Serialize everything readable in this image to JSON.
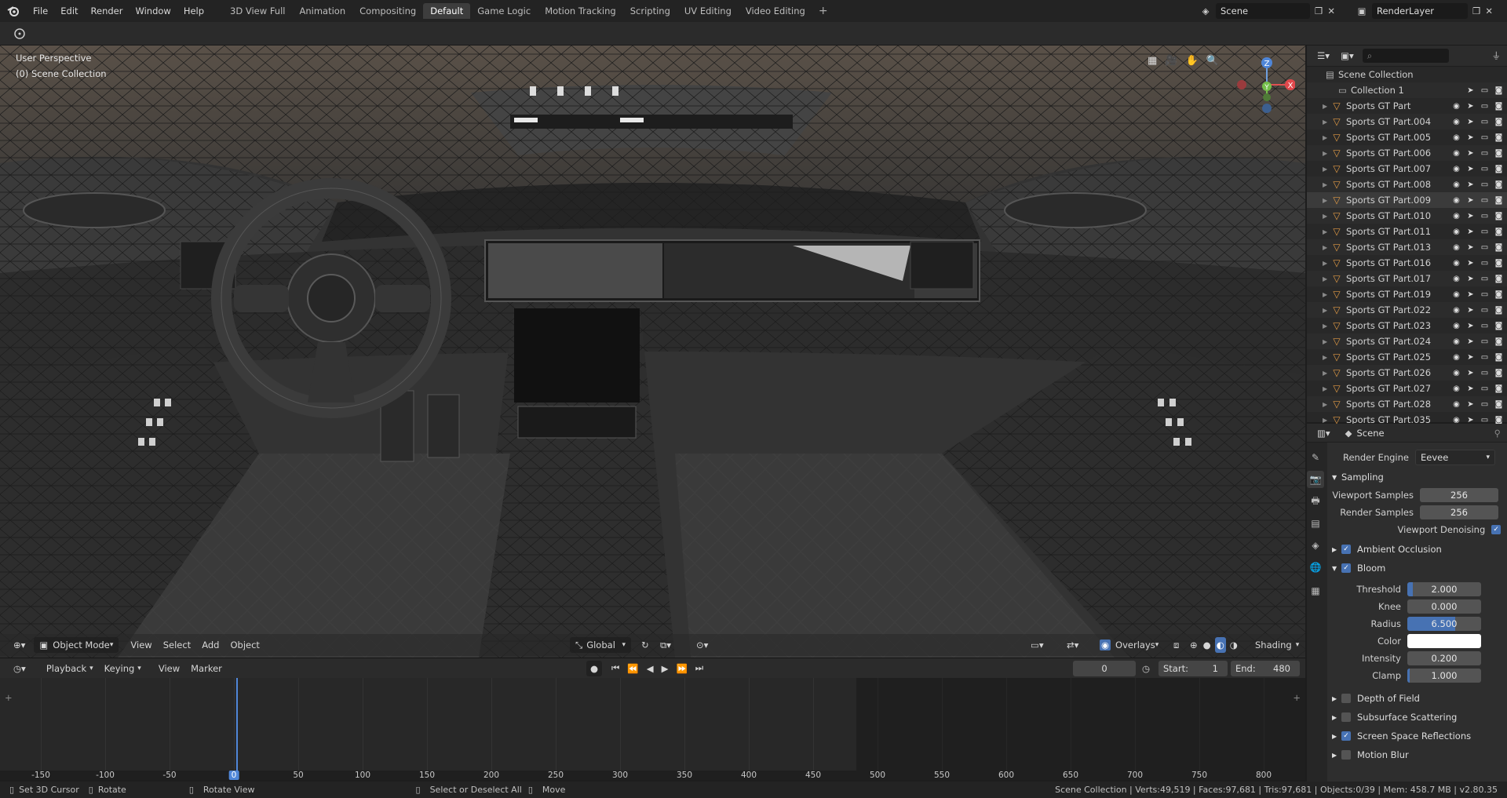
{
  "menu": {
    "items": [
      "File",
      "Edit",
      "Render",
      "Window",
      "Help"
    ]
  },
  "workspaces": {
    "tabs": [
      "3D View Full",
      "Animation",
      "Compositing",
      "Default",
      "Game Logic",
      "Motion Tracking",
      "Scripting",
      "UV Editing",
      "Video Editing"
    ],
    "active": "Default",
    "add_label": "+"
  },
  "scene": {
    "name": "Scene",
    "render_layer": "RenderLayer"
  },
  "viewport": {
    "perspective_label": "User Perspective",
    "collection_label": "(0) Scene Collection",
    "header": {
      "mode": "Object Mode",
      "view": "View",
      "select": "Select",
      "add": "Add",
      "object": "Object",
      "orientation": "Global",
      "overlays": "Overlays",
      "shading": "Shading"
    }
  },
  "timeline": {
    "playback": "Playback",
    "keying": "Keying",
    "view": "View",
    "marker": "Marker",
    "current_frame": "0",
    "start_label": "Start:",
    "start": "1",
    "end_label": "End:",
    "end": "480",
    "ticks": [
      "-150",
      "-100",
      "-50",
      "0",
      "50",
      "100",
      "150",
      "200",
      "250",
      "300",
      "350",
      "400",
      "450",
      "500",
      "550",
      "600",
      "650",
      "700",
      "750",
      "800"
    ]
  },
  "outliner": {
    "root": "Scene Collection",
    "collection": "Collection 1",
    "items": [
      "Sports GT Part",
      "Sports GT Part.004",
      "Sports GT Part.005",
      "Sports GT Part.006",
      "Sports GT Part.007",
      "Sports GT Part.008",
      "Sports GT Part.009",
      "Sports GT Part.010",
      "Sports GT Part.011",
      "Sports GT Part.013",
      "Sports GT Part.016",
      "Sports GT Part.017",
      "Sports GT Part.019",
      "Sports GT Part.022",
      "Sports GT Part.023",
      "Sports GT Part.024",
      "Sports GT Part.025",
      "Sports GT Part.026",
      "Sports GT Part.027",
      "Sports GT Part.028",
      "Sports GT Part.035"
    ],
    "highlighted": "Sports GT Part.009"
  },
  "properties": {
    "context": "Scene",
    "render_engine_label": "Render Engine",
    "render_engine": "Eevee",
    "sampling": {
      "title": "Sampling",
      "viewport_samples_label": "Viewport Samples",
      "viewport_samples": "256",
      "render_samples_label": "Render Samples",
      "render_samples": "256",
      "denoise_label": "Viewport Denoising"
    },
    "ambient_occlusion": "Ambient Occlusion",
    "bloom": {
      "title": "Bloom",
      "threshold_label": "Threshold",
      "threshold": "2.000",
      "threshold_fill": 0.07,
      "knee_label": "Knee",
      "knee": "0.000",
      "knee_fill": 0.0,
      "radius_label": "Radius",
      "radius": "6.500",
      "radius_fill": 0.65,
      "color_label": "Color",
      "color": "#ffffff",
      "intensity_label": "Intensity",
      "intensity": "0.200",
      "intensity_fill": 0.0,
      "clamp_label": "Clamp",
      "clamp": "1.000",
      "clamp_fill": 0.03
    },
    "panels": [
      {
        "title": "Depth of Field",
        "checked": false
      },
      {
        "title": "Subsurface Scattering",
        "checked": false
      },
      {
        "title": "Screen Space Reflections",
        "checked": true
      },
      {
        "title": "Motion Blur",
        "checked": false
      }
    ]
  },
  "status": {
    "set_cursor": "Set 3D Cursor",
    "rotate": "Rotate",
    "rotate_view": "Rotate View",
    "select": "Select or Deselect All",
    "move": "Move",
    "stats": "Scene Collection | Verts:49,519 | Faces:97,681 | Tris:97,681 | Objects:0/39 | Mem: 458.7 MB | v2.80.35"
  },
  "colors": {
    "accent": "#4772b3",
    "mesh_icon": "#e09a45"
  }
}
